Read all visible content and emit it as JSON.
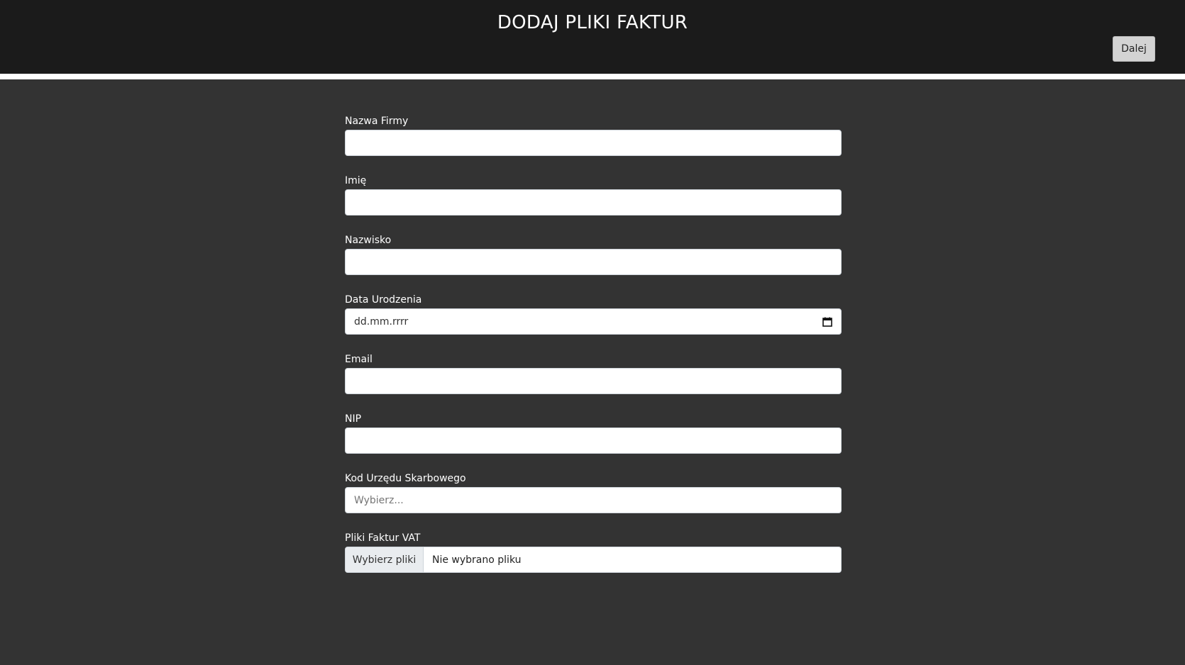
{
  "header": {
    "title": "DODAJ PLIKI FAKTUR",
    "next_label": "Dalej"
  },
  "form": {
    "company_name": {
      "label": "Nazwa Firmy",
      "value": ""
    },
    "first_name": {
      "label": "Imię",
      "value": ""
    },
    "last_name": {
      "label": "Nazwisko",
      "value": ""
    },
    "birth_date": {
      "label": "Data Urodzenia",
      "placeholder": "dd.mm.rrrr",
      "icon": "calendar-icon"
    },
    "email": {
      "label": "Email",
      "value": ""
    },
    "nip": {
      "label": "NIP",
      "value": ""
    },
    "tax_office": {
      "label": "Kod Urzędu Skarbowego",
      "placeholder": "Wybierz..."
    },
    "invoice_files": {
      "label": "Pliki Faktur VAT",
      "button_label": "Wybierz pliki",
      "status": "Nie wybrano pliku"
    }
  },
  "colors": {
    "header_bg": "#1b1b1b",
    "page_bg": "#333333",
    "next_button_bg": "#d3d3d3"
  }
}
